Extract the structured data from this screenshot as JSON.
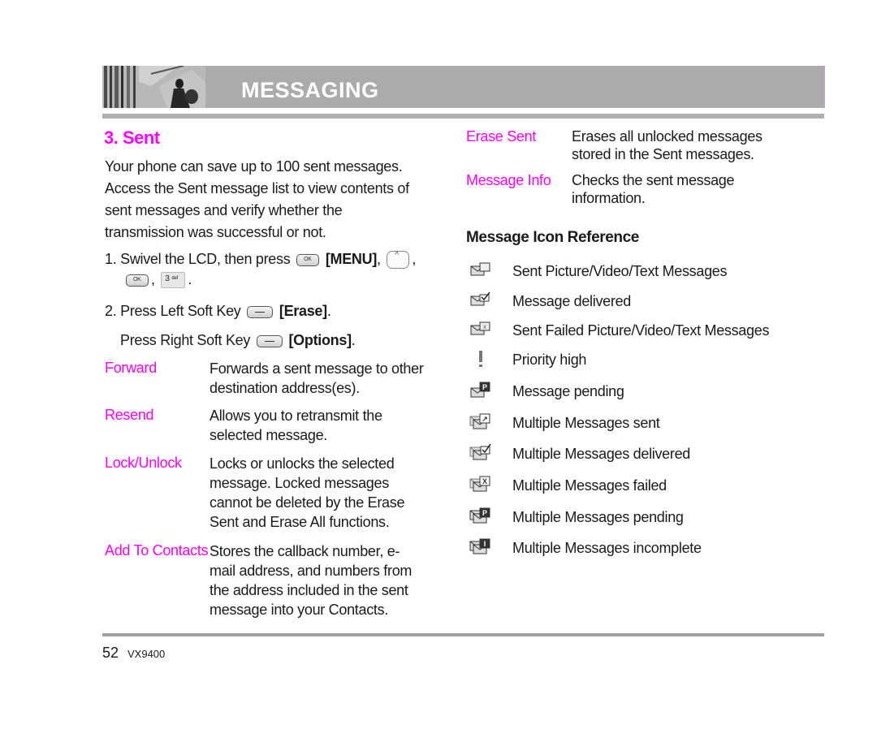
{
  "header": {
    "title": "MESSAGING"
  },
  "section": {
    "title": "3. Sent",
    "intro": [
      "Your phone can save up to 100 sent messages.",
      "Access the Sent message list to view contents of",
      "sent messages and verify whether the",
      "transmission was successful or not."
    ],
    "steps": {
      "step1_prefix": "1. Swivel the LCD, then press",
      "step1_menu": "[MENU]",
      "comma": ",",
      "period": ".",
      "ok_key": "OK",
      "three_key": "3",
      "three_key_sub": "def",
      "step2_prefix": "2. Press Left Soft Key",
      "step2_label": "[Erase]",
      "step3_prefix": "Press Right Soft Key",
      "step3_label": "[Options]"
    },
    "options": [
      {
        "label": "Forward",
        "desc": [
          "Forwards a sent message to other",
          "destination address(es)."
        ]
      },
      {
        "label": "Resend",
        "desc": [
          "Allows you to retransmit the",
          "selected message."
        ]
      },
      {
        "label": "Lock/Unlock",
        "desc": [
          "Locks or unlocks the selected",
          "message. Locked messages",
          "cannot be deleted by the Erase",
          "Sent and Erase All functions."
        ]
      },
      {
        "label": "Add To Contacts",
        "desc": [
          "Stores the callback number, e-",
          "mail address, and numbers from",
          "the address included in the sent",
          "message into your Contacts."
        ]
      },
      {
        "label": "Erase Sent",
        "desc": [
          "Erases all unlocked messages",
          "stored in the Sent messages."
        ]
      },
      {
        "label": "Message Info",
        "desc": [
          "Checks the sent message",
          "information."
        ]
      }
    ]
  },
  "icon_reference": {
    "title": "Message Icon Reference",
    "items": [
      {
        "icon": "sent-message-icon",
        "label": "Sent Picture/Video/Text Messages"
      },
      {
        "icon": "message-delivered-icon",
        "label": "Message delivered"
      },
      {
        "icon": "sent-failed-icon",
        "label": "Sent Failed Picture/Video/Text Messages"
      },
      {
        "icon": "priority-high-icon",
        "label": "Priority high"
      },
      {
        "icon": "message-pending-icon",
        "label": "Message pending"
      },
      {
        "icon": "multiple-sent-icon",
        "label": "Multiple Messages sent"
      },
      {
        "icon": "multiple-delivered-icon",
        "label": "Multiple Messages delivered"
      },
      {
        "icon": "multiple-failed-icon",
        "label": "Multiple Messages failed"
      },
      {
        "icon": "multiple-pending-icon",
        "label": "Multiple Messages pending"
      },
      {
        "icon": "multiple-incomplete-icon",
        "label": "Multiple Messages incomplete"
      }
    ]
  },
  "footer": {
    "page_number": "52",
    "model": "VX9400"
  },
  "colors": {
    "accent": "#ff00ff",
    "banner": "#ababab",
    "text": "#1a1a1a"
  }
}
